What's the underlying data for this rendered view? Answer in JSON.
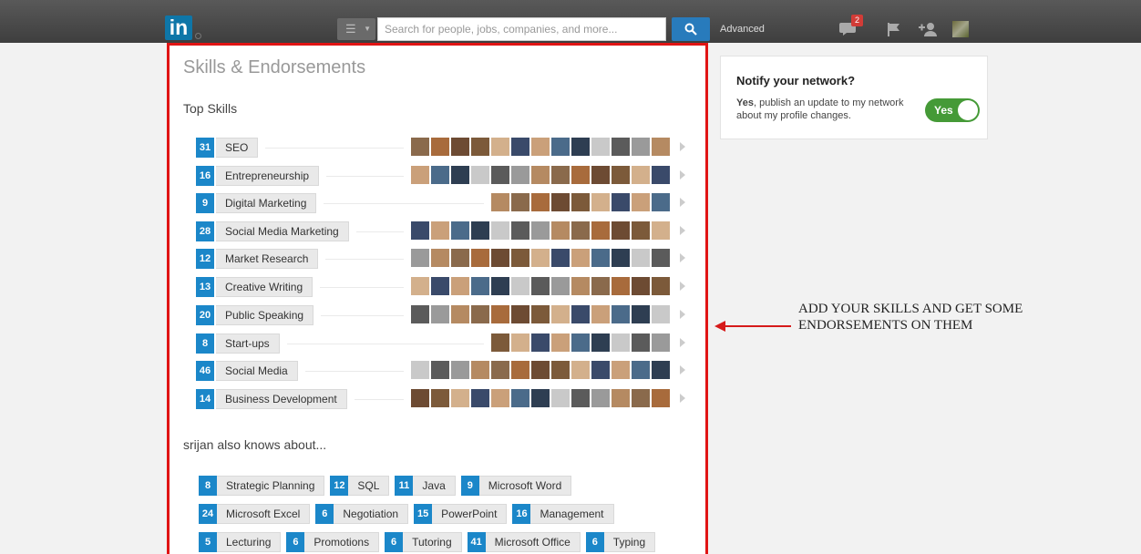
{
  "header": {
    "logo_text": "in",
    "search_placeholder": "Search for people, jobs, companies, and more...",
    "advanced_label": "Advanced",
    "messages_badge": "2",
    "icons": [
      "menu-icon",
      "search-icon",
      "messages-icon",
      "flag-icon",
      "add-connection-icon",
      "profile-avatar"
    ]
  },
  "skills_section": {
    "title": "Skills & Endorsements",
    "top_skills_label": "Top Skills",
    "top_skills": [
      {
        "count": "31",
        "name": "SEO"
      },
      {
        "count": "16",
        "name": "Entrepreneurship"
      },
      {
        "count": "9",
        "name": "Digital Marketing"
      },
      {
        "count": "28",
        "name": "Social Media Marketing"
      },
      {
        "count": "12",
        "name": "Market Research"
      },
      {
        "count": "13",
        "name": "Creative Writing"
      },
      {
        "count": "20",
        "name": "Public Speaking"
      },
      {
        "count": "8",
        "name": "Start-ups"
      },
      {
        "count": "46",
        "name": "Social Media"
      },
      {
        "count": "14",
        "name": "Business Development"
      }
    ],
    "also_knows_label": "srijan also knows about...",
    "other_skills": [
      [
        {
          "count": "8",
          "name": "Strategic Planning"
        },
        {
          "count": "12",
          "name": "SQL"
        },
        {
          "count": "11",
          "name": "Java"
        },
        {
          "count": "9",
          "name": "Microsoft Word"
        }
      ],
      [
        {
          "count": "24",
          "name": "Microsoft Excel"
        },
        {
          "count": "6",
          "name": "Negotiation"
        },
        {
          "count": "15",
          "name": "PowerPoint"
        },
        {
          "count": "16",
          "name": "Management"
        }
      ],
      [
        {
          "count": "5",
          "name": "Lecturing"
        },
        {
          "count": "6",
          "name": "Promotions"
        },
        {
          "count": "6",
          "name": "Tutoring"
        },
        {
          "count": "41",
          "name": "Microsoft Office"
        },
        {
          "count": "6",
          "name": "Typing"
        }
      ]
    ]
  },
  "notify": {
    "title": "Notify your network?",
    "text_bold": "Yes",
    "text_rest": ", publish an update to my network about my profile changes.",
    "toggle_label": "Yes"
  },
  "annotation": {
    "text": "ADD YOUR SKILLS AND GET SOME ENDORSEMENTS ON THEM"
  },
  "colors": {
    "accent": "#1b87c9",
    "highlight_border": "#e01414",
    "toggle_on": "#459a37"
  }
}
